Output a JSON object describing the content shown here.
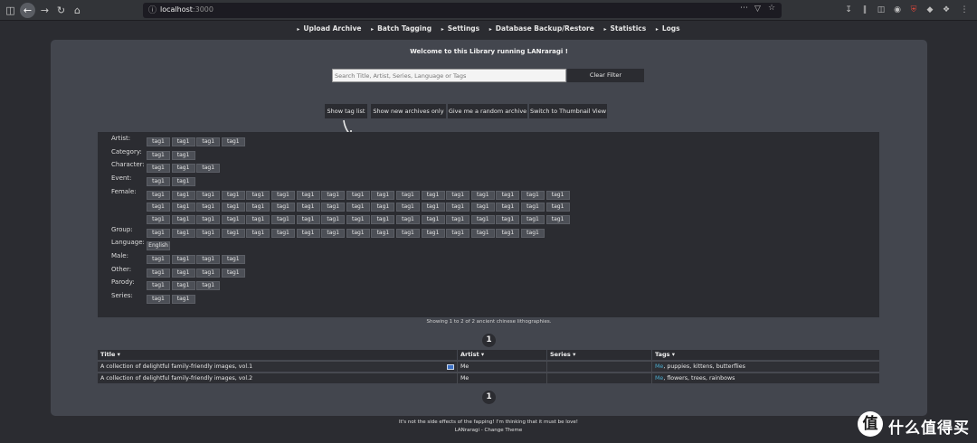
{
  "browser": {
    "url_host": "localhost",
    "url_port": ":3000"
  },
  "nav": {
    "items": [
      "Upload Archive",
      "Batch Tagging",
      "Settings",
      "Database Backup/Restore",
      "Statistics",
      "Logs"
    ]
  },
  "welcome": "Welcome to this Library running LANraragi !",
  "search": {
    "placeholder": "Search Title, Artist, Series, Language or Tags",
    "clear_label": "Clear Filter"
  },
  "buttons": {
    "show_tag_list": "Show tag list",
    "show_new": "Show new archives only",
    "random": "Give me a random archive",
    "thumbnail": "Switch to Thumbnail View"
  },
  "tag_categories": [
    {
      "label": "Artist:",
      "rows": [
        [
          "tag1",
          "tag1",
          "tag1",
          "tag1"
        ]
      ]
    },
    {
      "label": "Category:",
      "rows": [
        [
          "tag1",
          "tag1"
        ]
      ]
    },
    {
      "label": "Character:",
      "rows": [
        [
          "tag1",
          "tag1",
          "tag1"
        ]
      ]
    },
    {
      "label": "Event:",
      "rows": [
        [
          "tag1",
          "tag1"
        ]
      ]
    },
    {
      "label": "Female:",
      "rows": [
        [
          "tag1",
          "tag1",
          "tag1",
          "tag1",
          "tag1",
          "tag1",
          "tag1",
          "tag1",
          "tag1",
          "tag1",
          "tag1",
          "tag1",
          "tag1",
          "tag1",
          "tag1",
          "tag1",
          "tag1"
        ],
        [
          "tag1",
          "tag1",
          "tag1",
          "tag1",
          "tag1",
          "tag1",
          "tag1",
          "tag1",
          "tag1",
          "tag1",
          "tag1",
          "tag1",
          "tag1",
          "tag1",
          "tag1",
          "tag1",
          "tag1"
        ],
        [
          "tag1",
          "tag1",
          "tag1",
          "tag1",
          "tag1",
          "tag1",
          "tag1",
          "tag1",
          "tag1",
          "tag1",
          "tag1",
          "tag1",
          "tag1",
          "tag1",
          "tag1",
          "tag1",
          "tag1"
        ]
      ]
    },
    {
      "label": "Group:",
      "rows": [
        [
          "tag1",
          "tag1",
          "tag1",
          "tag1",
          "tag1",
          "tag1",
          "tag1",
          "tag1",
          "tag1",
          "tag1",
          "tag1",
          "tag1",
          "tag1",
          "tag1",
          "tag1",
          "tag1"
        ]
      ]
    },
    {
      "label": "Language:",
      "rows": [
        [
          "English"
        ]
      ]
    },
    {
      "label": "Male:",
      "rows": [
        [
          "tag1",
          "tag1",
          "tag1",
          "tag1"
        ]
      ]
    },
    {
      "label": "Other:",
      "rows": [
        [
          "tag1",
          "tag1",
          "tag1",
          "tag1"
        ]
      ]
    },
    {
      "label": "Parody:",
      "rows": [
        [
          "tag1",
          "tag1",
          "tag1"
        ]
      ]
    },
    {
      "label": "Series:",
      "rows": [
        [
          "tag1",
          "tag1"
        ]
      ]
    }
  ],
  "showing": "Showing 1 to 2 of 2 ancient chinese lithographies.",
  "pagination": {
    "current": "1"
  },
  "table": {
    "headers": [
      "Title",
      "Artist",
      "Series",
      "Tags"
    ],
    "rows": [
      {
        "title": "A collection of delightful family-friendly images, vol.1",
        "artist": "Me",
        "series": "",
        "tag_link": "Me",
        "tags_rest": ", puppies, kittens, butterflies",
        "new": true
      },
      {
        "title": "A collection of delightful family-friendly images, vol.2",
        "artist": "Me",
        "series": "",
        "tag_link": "Me",
        "tags_rest": ", flowers, trees, rainbows",
        "new": false
      }
    ]
  },
  "footer": {
    "line1": "It's not the side effects of the fapping! I'm thinking that it must be love!",
    "line2": "LANraragi - Change Theme"
  },
  "watermark": {
    "glyph": "值",
    "text": "什么值得买"
  }
}
